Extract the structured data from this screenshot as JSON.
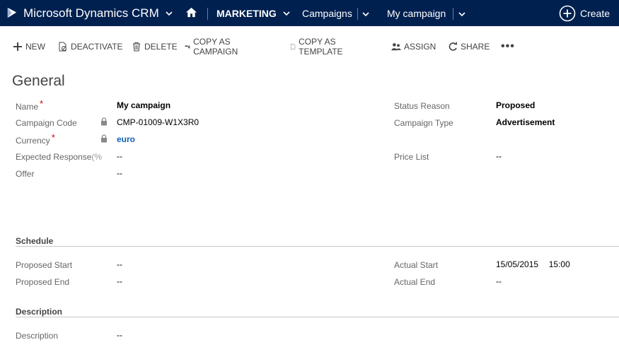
{
  "topnav": {
    "brand": "Microsoft Dynamics CRM",
    "area": "MARKETING",
    "entity": "Campaigns",
    "record": "My campaign",
    "create": "Create"
  },
  "commands": {
    "new": "NEW",
    "deactivate": "DEACTIVATE",
    "delete": "DELETE",
    "copy_as_campaign": "COPY AS CAMPAIGN",
    "copy_as_template": "COPY AS TEMPLATE",
    "assign": "ASSIGN",
    "share": "SHARE",
    "more": "•••"
  },
  "general": {
    "title": "General",
    "fields": {
      "name": {
        "label": "Name",
        "value": "My campaign",
        "required": "*"
      },
      "campaign_code": {
        "label": "Campaign Code",
        "value": "CMP-01009-W1X3R0"
      },
      "currency": {
        "label": "Currency",
        "value": "euro",
        "required": "*"
      },
      "expected_response": {
        "label": "Expected Response",
        "suffix": "(%",
        "value": "--"
      },
      "offer": {
        "label": "Offer",
        "value": "--"
      },
      "status_reason": {
        "label": "Status Reason",
        "value": "Proposed"
      },
      "campaign_type": {
        "label": "Campaign Type",
        "value": "Advertisement"
      },
      "price_list": {
        "label": "Price List",
        "value": "--"
      }
    }
  },
  "schedule": {
    "title": "Schedule",
    "proposed_start": {
      "label": "Proposed Start",
      "value": "--"
    },
    "proposed_end": {
      "label": "Proposed End",
      "value": "--"
    },
    "actual_start": {
      "label": "Actual Start",
      "date": "15/05/2015",
      "time": "15:00"
    },
    "actual_end": {
      "label": "Actual End",
      "value": "--"
    }
  },
  "description": {
    "title": "Description",
    "field": {
      "label": "Description",
      "value": "--"
    }
  },
  "colors": {
    "nav_bg": "#002050",
    "link": "#1160b7",
    "required": "#cc0000"
  }
}
